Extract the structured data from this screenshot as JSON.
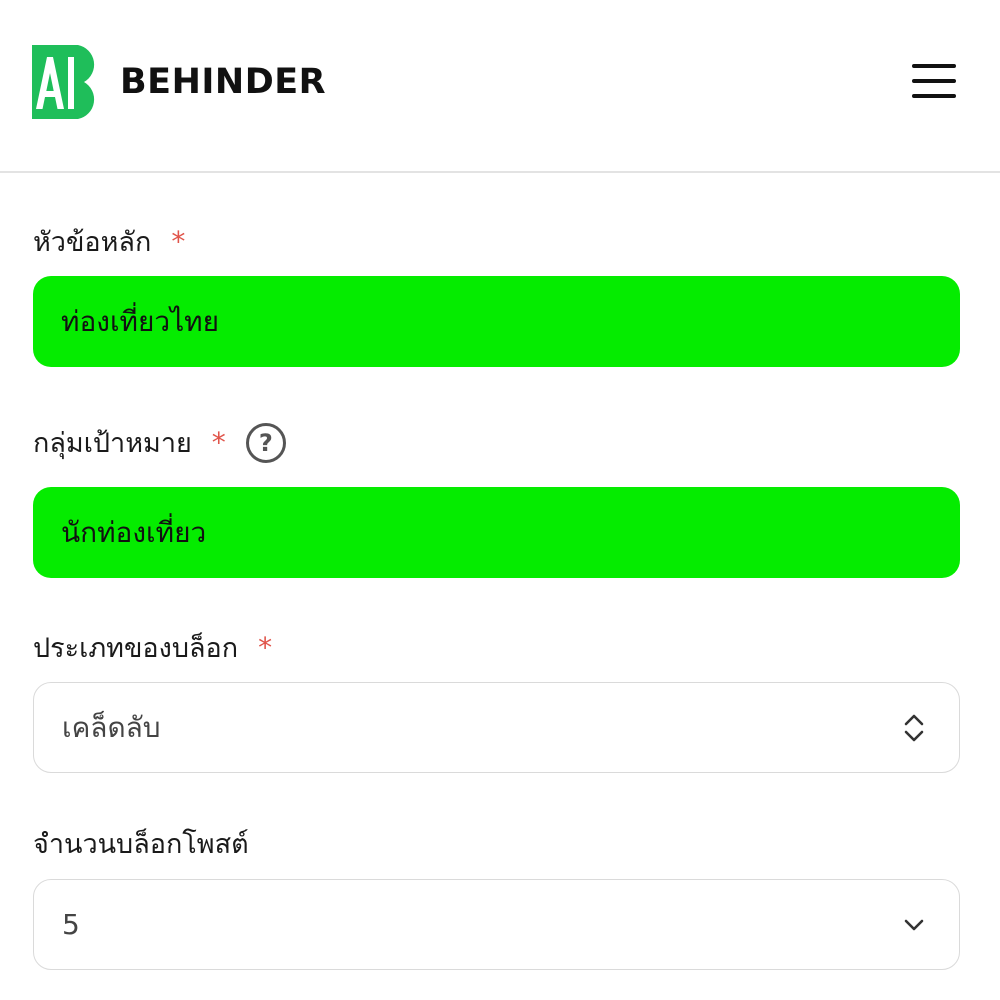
{
  "header": {
    "logo_mark": "AI",
    "brand_name": "BEHINDER",
    "brand_color": "#1fbe5a",
    "menu_icon": "hamburger-menu-icon"
  },
  "form": {
    "topic": {
      "label": "หัวข้อหลัก",
      "required_mark": "*",
      "value": "ท่องเที่ยวไทย"
    },
    "audience": {
      "label": "กลุ่มเป้าหมาย",
      "required_mark": "*",
      "help_icon": "?",
      "value": "นักท่องเที่ยว"
    },
    "blog_type": {
      "label": "ประเภทของบล็อก",
      "required_mark": "*",
      "value": "เคล็ดลับ"
    },
    "post_count": {
      "label": "จำนวนบล็อกโพสต์",
      "value": "5"
    }
  },
  "colors": {
    "filled_input_bg": "#05ec00",
    "required": "#e0544a"
  }
}
